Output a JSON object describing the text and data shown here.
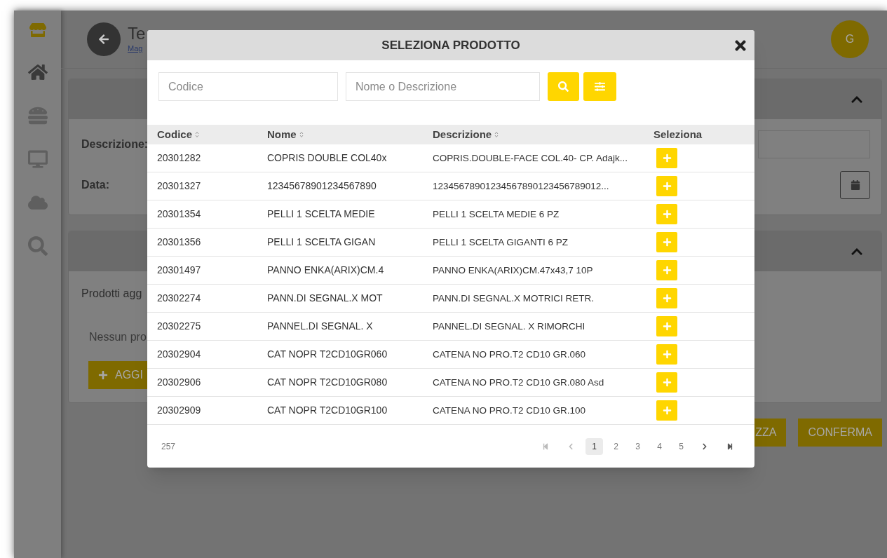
{
  "page": {
    "title": "Te",
    "breadcrumb": "Mag",
    "avatar": "G",
    "card_details": {
      "fields": [
        {
          "label": "Descrizione:",
          "kind": "text"
        },
        {
          "label": "Data:",
          "kind": "date"
        }
      ]
    },
    "card_products": {
      "label": "Prodotti agg",
      "empty": "Nessun pro",
      "add_button": "AGGI"
    },
    "actions": [
      "ZZA",
      "CONFERMA"
    ]
  },
  "dialog": {
    "title": "SELEZIONA PRODOTTO",
    "search": [
      {
        "placeholder": "Codice"
      },
      {
        "placeholder": "Nome o Descrizione"
      }
    ],
    "columns": [
      {
        "label": "Codice",
        "sortable": true
      },
      {
        "label": "Nome",
        "sortable": true
      },
      {
        "label": "Descrizione",
        "sortable": true
      },
      {
        "label": "Seleziona",
        "sortable": false
      }
    ],
    "rows": [
      {
        "code": "20301282",
        "name": "COPRIS DOUBLE COL40x",
        "description": "COPRIS.DOUBLE-FACE COL.40- CP. Adajk..."
      },
      {
        "code": "20301327",
        "name": "12345678901234567890",
        "description": "12345678901234567890123456789012..."
      },
      {
        "code": "20301354",
        "name": "PELLI 1 SCELTA MEDIE",
        "description": "PELLI 1 SCELTA MEDIE 6 PZ"
      },
      {
        "code": "20301356",
        "name": "PELLI 1 SCELTA GIGAN",
        "description": "PELLI 1 SCELTA GIGANTI 6 PZ"
      },
      {
        "code": "20301497",
        "name": "PANNO ENKA(ARIX)CM.4",
        "description": "PANNO ENKA(ARIX)CM.47x43,7 10P"
      },
      {
        "code": "20302274",
        "name": "PANN.DI SEGNAL.X MOT",
        "description": "PANN.DI SEGNAL.X MOTRICI RETR."
      },
      {
        "code": "20302275",
        "name": "PANNEL.DI SEGNAL. X",
        "description": "PANNEL.DI SEGNAL. X RIMORCHI"
      },
      {
        "code": "20302904",
        "name": "CAT NOPR T2CD10GR060",
        "description": "CATENA NO PRO.T2 CD10 GR.060"
      },
      {
        "code": "20302906",
        "name": "CAT NOPR T2CD10GR080",
        "description": "CATENA NO PRO.T2 CD10 GR.080 Asd"
      },
      {
        "code": "20302909",
        "name": "CAT NOPR T2CD10GR100",
        "description": "CATENA NO PRO.T2 CD10 GR.100"
      }
    ],
    "total": "257",
    "pager": {
      "first_disabled": true,
      "prev_disabled": true,
      "next_disabled": false,
      "last_disabled": false,
      "pages": [
        {
          "label": "1",
          "selected": true
        },
        {
          "label": "2",
          "selected": false
        },
        {
          "label": "3",
          "selected": false
        },
        {
          "label": "4",
          "selected": false
        },
        {
          "label": "5",
          "selected": false
        }
      ]
    }
  }
}
